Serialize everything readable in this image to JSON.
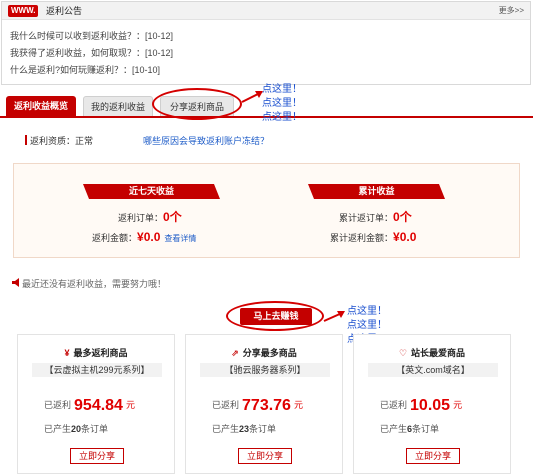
{
  "notice": {
    "logo": "WWW.",
    "title": "返利公告",
    "more": "更多>>",
    "items": [
      "我什么时候可以收到返利收益？：[10-12]",
      "我获得了返利收益，如何取现？：[10-12]",
      "什么是返利?如何玩赚返利？：[10-10]"
    ]
  },
  "tabs": [
    {
      "label": "返利收益概览",
      "active": true
    },
    {
      "label": "我的返利收益",
      "active": false
    },
    {
      "label": "分享返利商品",
      "active": false
    }
  ],
  "hints": {
    "text": "点这里！"
  },
  "status": {
    "label": "返利资质：",
    "value": "正常",
    "link": "哪些原因会导致返利账户冻结？"
  },
  "earnings": {
    "week": {
      "title": "近七天收益",
      "orders_label": "返利订单：",
      "orders_value": "0个",
      "amount_label": "返利金额：",
      "amount_value": "¥0.0",
      "detail_link": "查看详情"
    },
    "total": {
      "title": "累计收益",
      "orders_label": "累计返订单：",
      "orders_value": "0个",
      "amount_label": "累计返利金额：",
      "amount_value": "¥0.0"
    }
  },
  "info": "最近还没有返利收益，需要努力哦！",
  "earn_button": "马上去赚钱",
  "cards": [
    {
      "title": "最多返利商品",
      "icon": "yen-icon",
      "product": "【云虚拟主机299元系列】",
      "earned_label": "已返利",
      "earned": "954.84",
      "unit": "元",
      "orders_prefix": "已产生",
      "orders_count": "20",
      "orders_suffix": "条订单",
      "share": "立即分享"
    },
    {
      "title": "分享最多商品",
      "icon": "share-icon",
      "product": "【驰云服务器系列】",
      "earned_label": "已返利",
      "earned": "773.76",
      "unit": "元",
      "orders_prefix": "已产生",
      "orders_count": "23",
      "orders_suffix": "条订单",
      "share": "立即分享"
    },
    {
      "title": "站长最爱商品",
      "icon": "heart-icon",
      "product": "【英文.com域名】",
      "earned_label": "已返利",
      "earned": "10.05",
      "unit": "元",
      "orders_prefix": "已产生",
      "orders_count": "6",
      "orders_suffix": "条订单",
      "share": "立即分享"
    }
  ],
  "colors": {
    "accent": "#c40000",
    "link": "#1e5cc8",
    "hint": "#1a4fcf"
  }
}
